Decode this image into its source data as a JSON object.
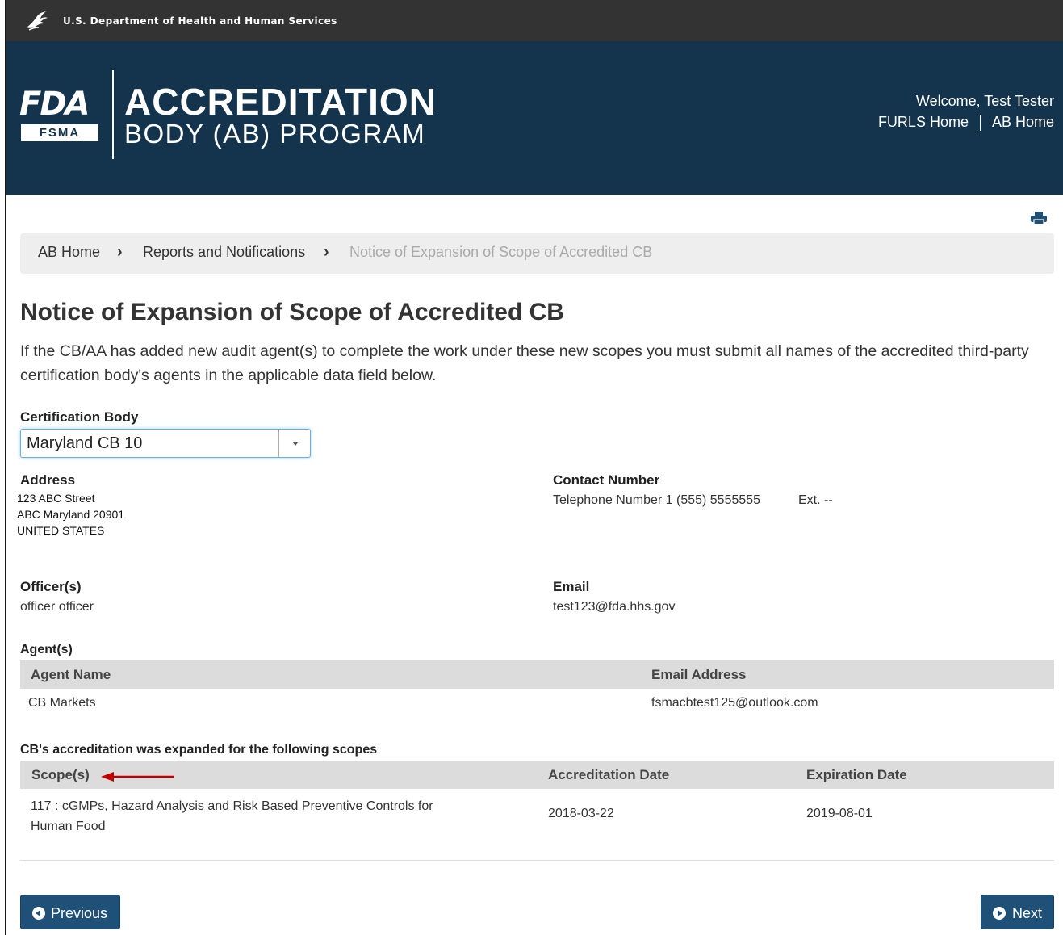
{
  "top_bar": {
    "agency": "U.S. Department of Health and Human Services"
  },
  "banner": {
    "logo_fda": "FDA",
    "logo_fsma": "FSMA",
    "title_line1": "ACCREDITATION",
    "title_line2": "BODY (AB) PROGRAM",
    "welcome": "Welcome, Test Tester",
    "link_furls": "FURLS Home",
    "link_ab": "AB Home",
    "color": "#13344c"
  },
  "breadcrumb": {
    "items": [
      "AB Home",
      "Reports and Notifications",
      "Notice of Expansion of Scope of Accredited CB"
    ]
  },
  "page": {
    "title": "Notice of Expansion of Scope of Accredited CB",
    "intro": "If the CB/AA has added new audit agent(s) to complete the work under these new scopes you must submit all names of the accredited third-party certification body's agents in the applicable data field below."
  },
  "certification_body": {
    "label": "Certification Body",
    "selected": "Maryland CB 10"
  },
  "address": {
    "label": "Address",
    "line1": "123 ABC Street",
    "line2": "ABC Maryland 20901",
    "line3": "UNITED STATES"
  },
  "contact": {
    "label": "Contact Number",
    "value": "Telephone Number 1 (555) 5555555",
    "ext": "Ext. --"
  },
  "officers": {
    "label": "Officer(s)",
    "value": "officer officer"
  },
  "email": {
    "label": "Email",
    "value": "test123@fda.hhs.gov"
  },
  "agents": {
    "label": "Agent(s)",
    "columns": [
      "Agent Name",
      "Email Address"
    ],
    "rows": [
      {
        "name": "CB Markets",
        "email": "fsmacbtest125@outlook.com"
      }
    ]
  },
  "scopes": {
    "label": "CB's accreditation was expanded for the following scopes",
    "columns": [
      "Scope(s)",
      "Accreditation Date",
      "Expiration Date"
    ],
    "rows": [
      {
        "scope_line1": "117 : cGMPs, Hazard Analysis and Risk Based Preventive Controls for",
        "scope_line2": "Human Food",
        "accreditation_date": "2018-03-22",
        "expiration_date": "2019-08-01"
      }
    ]
  },
  "buttons": {
    "previous": "Previous",
    "next": "Next",
    "color": "#1f5178"
  },
  "annotation": {
    "arrow_color": "#c00000"
  }
}
